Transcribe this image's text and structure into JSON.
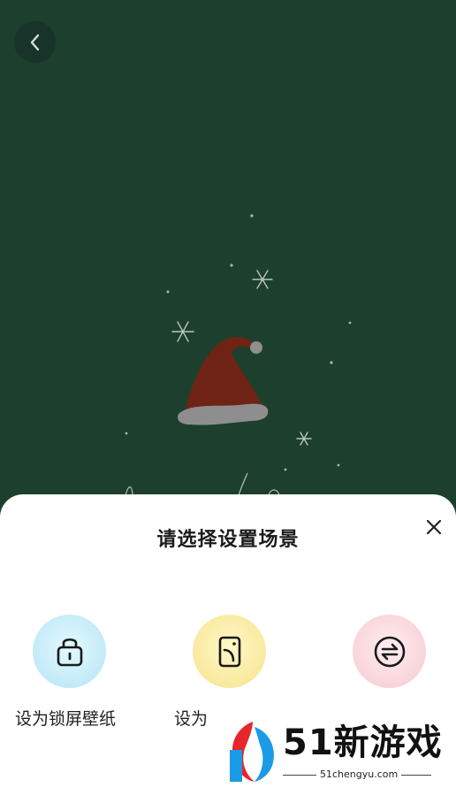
{
  "background_color": "#1d3f2e",
  "navigation": {
    "back_icon": "chevron-left-icon"
  },
  "sheet": {
    "title": "请选择设置场景",
    "close_icon": "close-icon",
    "options": [
      {
        "label": "设为锁屏壁纸",
        "icon": "lock-icon"
      },
      {
        "label": "设为",
        "icon": "phone-screen-icon"
      },
      {
        "label": "",
        "icon": "swap-icon"
      }
    ]
  },
  "watermark": {
    "brand": "51新游戏",
    "url": "51chengyu.com",
    "logo_colors": [
      "#e5262b",
      "#1a9be6"
    ]
  }
}
